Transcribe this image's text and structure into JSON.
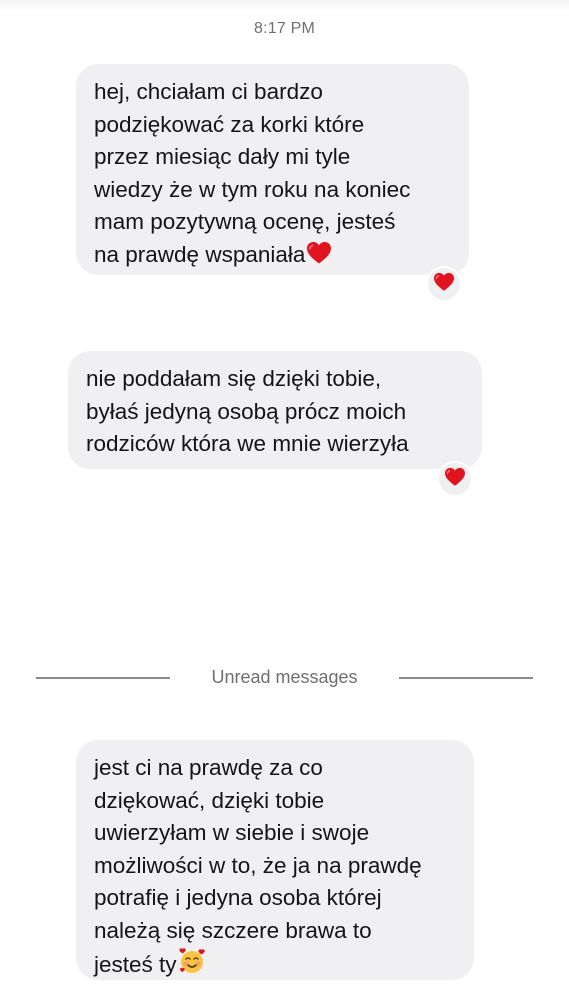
{
  "header": {
    "timestamp": "8:17 PM"
  },
  "messages": [
    {
      "lines": [
        "hej, chciałam ci bardzo",
        "podziękować za korki które",
        "przez miesiąc dały mi tyle",
        "wiedzy że w tym roku na koniec",
        "mam pozytywną ocenę, jesteś",
        "na prawdę wspaniała"
      ],
      "trailing_emoji": "red-heart",
      "reaction": "red-heart"
    },
    {
      "lines": [
        "nie poddałam się dzięki tobie,",
        "byłaś jedyną osobą prócz moich",
        "rodziców która we mnie wierzyła"
      ],
      "reaction": "red-heart"
    },
    {
      "lines": [
        "jest ci na prawdę za co",
        "dziękować, dzięki tobie",
        "uwierzyłam w siebie i swoje",
        "możliwości w to, że ja na prawdę",
        "potrafię i jedyna osoba której",
        "należą się szczere brawa to",
        "jesteś ty"
      ],
      "trailing_emoji": "smiling-face-with-hearts"
    }
  ],
  "divider": {
    "label": "Unread messages"
  },
  "colors": {
    "bubble": "#f0f0f2",
    "heart": "#e0141e",
    "divider": "#8a8a8a",
    "muted_text": "#707070"
  }
}
